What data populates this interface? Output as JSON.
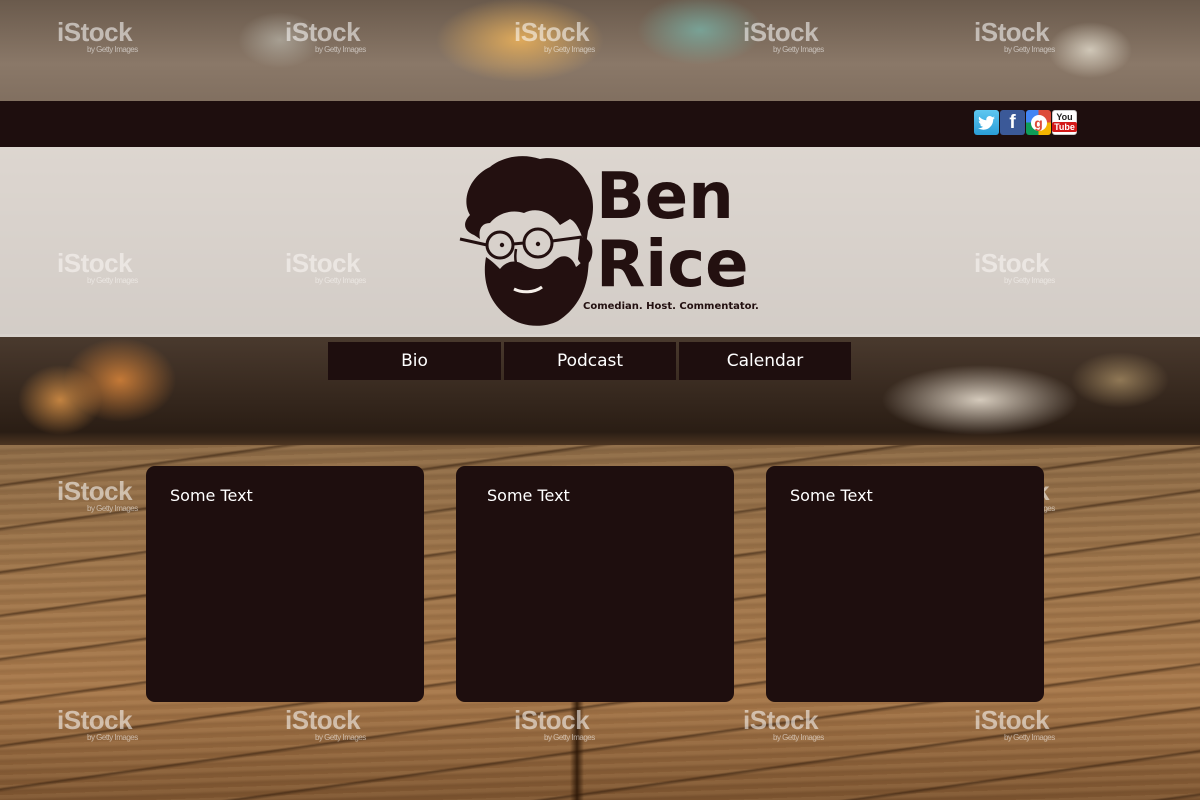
{
  "watermark": {
    "brand": "iStock",
    "sub": "by Getty Images"
  },
  "social": {
    "icons": [
      "twitter-icon",
      "facebook-icon",
      "google-plus-icon",
      "youtube-icon"
    ],
    "facebook_glyph": "f",
    "google_glyph": "g",
    "youtube_top": "You",
    "youtube_bottom": "Tube"
  },
  "header": {
    "logo_line_1": "Ben",
    "logo_line_2": "Rice",
    "tagline": "Comedian. Host. Commentator."
  },
  "nav": {
    "items": [
      {
        "label": "Bio"
      },
      {
        "label": "Podcast"
      },
      {
        "label": "Calendar"
      }
    ]
  },
  "cards": [
    {
      "title": "Some Text"
    },
    {
      "title": "Some Text"
    },
    {
      "title": "Some Text"
    }
  ],
  "colors": {
    "bar": "#1e0e0e",
    "header_band": "#faf6f2",
    "text_light": "#ffffff",
    "logo_ink": "#231010"
  }
}
